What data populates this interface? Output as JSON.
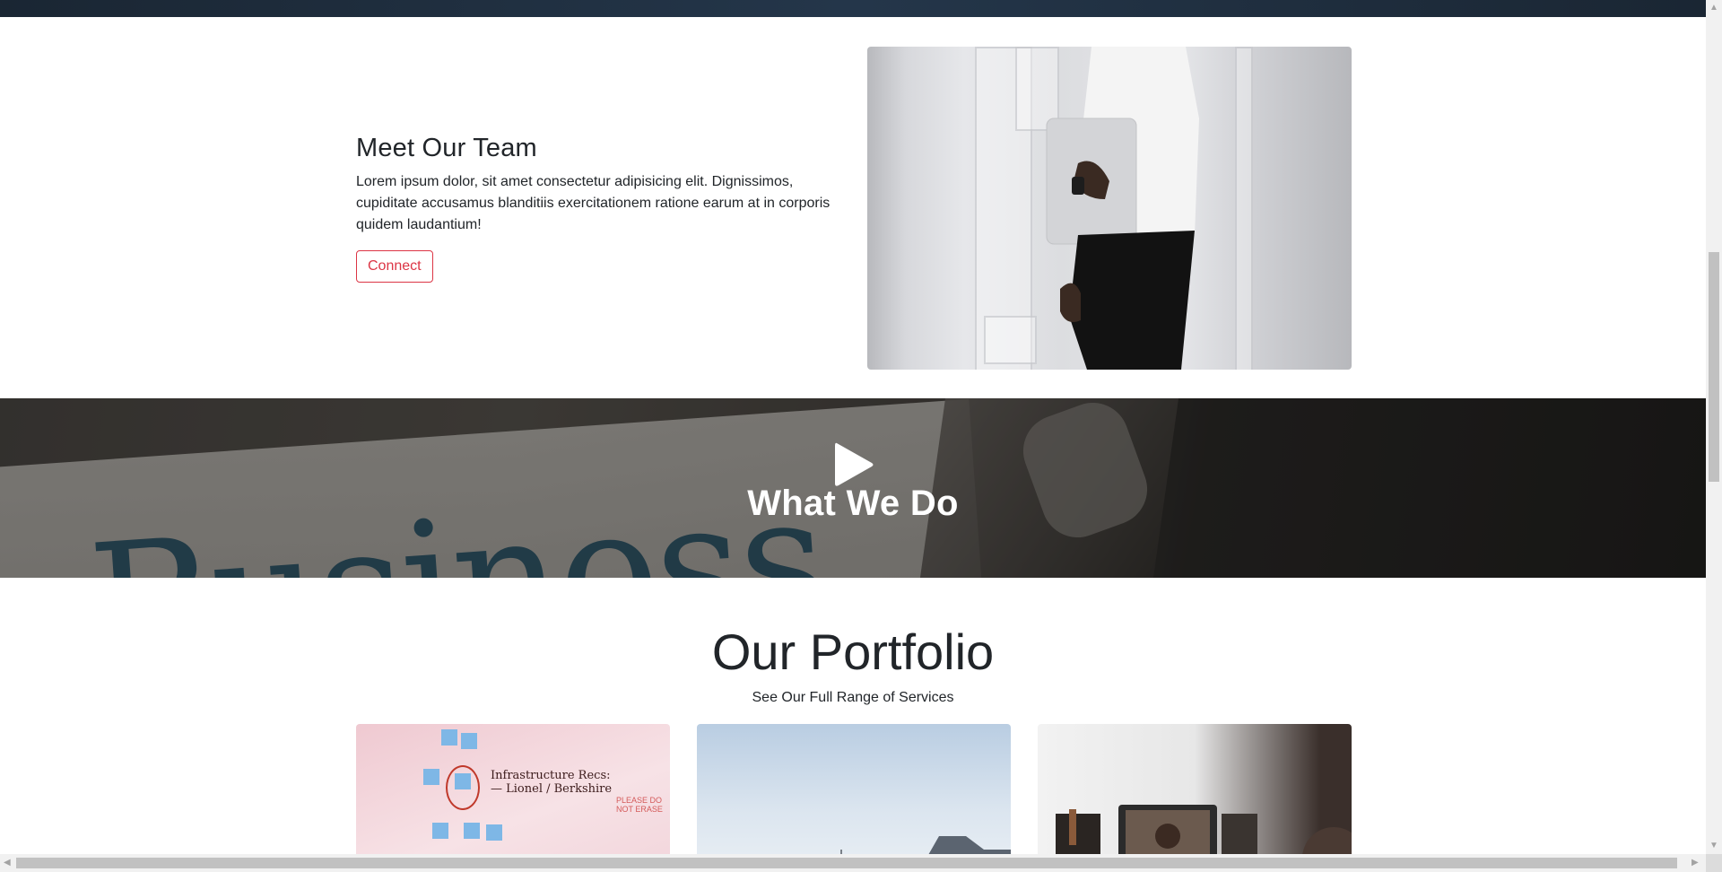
{
  "team": {
    "title": "Meet Our Team",
    "body": "Lorem ipsum dolor, sit amet consectetur adipisicing elit. Dignissimos, cupiditate accusamus blanditiis exercitationem ratione earum at in corporis quidem laudantium!",
    "button_label": "Connect",
    "accent_color": "#dc3545"
  },
  "banner": {
    "title": "What We Do",
    "play_icon": "play-icon",
    "background_word": "Business"
  },
  "portfolio": {
    "title": "Our Portfolio",
    "subtitle": "See Our Full Range of Services",
    "cards": [
      {
        "label": "Infrastructure Recs: — Lionel / Berkshire",
        "note": "PLEASE DO NOT ERASE"
      },
      {
        "label": ""
      },
      {
        "label": ""
      }
    ]
  },
  "scrollbars": {
    "vertical_position": 0.29,
    "horizontal_position": 0.0
  }
}
